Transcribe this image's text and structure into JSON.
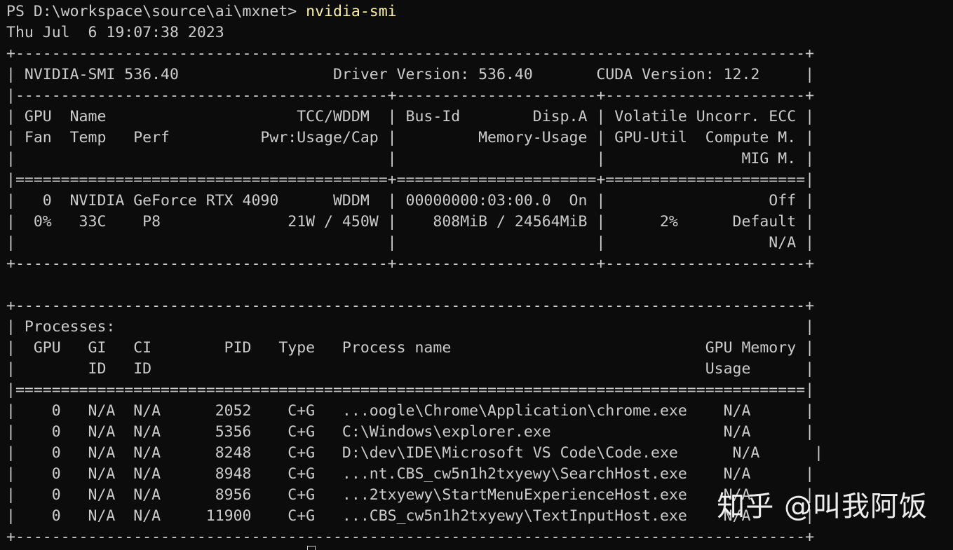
{
  "prompt": {
    "prefix": "PS D:\\workspace\\source\\ai\\mxnet> ",
    "command": "nvidia-smi"
  },
  "timestamp": "Thu Jul  6 19:07:38 2023",
  "gpu_table": [
    "+---------------------------------------------------------------------------------------+",
    "| NVIDIA-SMI 536.40                 Driver Version: 536.40       CUDA Version: 12.2     |",
    "|-----------------------------------------+----------------------+----------------------+",
    "| GPU  Name                     TCC/WDDM  | Bus-Id        Disp.A | Volatile Uncorr. ECC |",
    "| Fan  Temp   Perf          Pwr:Usage/Cap |         Memory-Usage | GPU-Util  Compute M. |",
    "|                                         |                      |               MIG M. |",
    "|=========================================+======================+======================|",
    "|   0  NVIDIA GeForce RTX 4090      WDDM  | 00000000:03:00.0  On |                  Off |",
    "|  0%   33C    P8              21W / 450W |    808MiB / 24564MiB |      2%      Default |",
    "|                                         |                      |                  N/A |",
    "+-----------------------------------------+----------------------+----------------------+"
  ],
  "blank_line": "",
  "process_table": [
    "+---------------------------------------------------------------------------------------+",
    "| Processes:                                                                            |",
    "|  GPU   GI   CI        PID   Type   Process name                            GPU Memory |",
    "|        ID   ID                                                             Usage      |",
    "|=======================================================================================|",
    "|    0   N/A  N/A      2052    C+G   ...oogle\\Chrome\\Application\\chrome.exe    N/A      |",
    "|    0   N/A  N/A      5356    C+G   C:\\Windows\\explorer.exe                   N/A      |",
    "|    0   N/A  N/A      8248    C+G   D:\\dev\\IDE\\Microsoft VS Code\\Code.exe      N/A      |",
    "|    0   N/A  N/A      8948    C+G   ...nt.CBS_cw5n1h2txyewy\\SearchHost.exe    N/A      |",
    "|    0   N/A  N/A      8956    C+G   ...2txyewy\\StartMenuExperienceHost.exe    N/A      |",
    "|    0   N/A  N/A     11900    C+G   ...CBS_cw5n1h2txyewy\\TextInputHost.exe    N/A      |",
    "+---------------------------------------------------------------------------------------+"
  ],
  "watermark": "知乎 @叫我阿饭",
  "colors": {
    "background": "#0c0c0c",
    "text": "#cccccc",
    "command": "#f9f1a5"
  }
}
